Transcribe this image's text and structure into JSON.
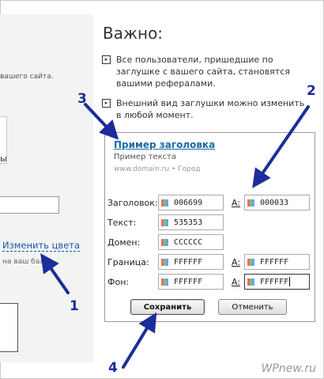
{
  "left": {
    "text1": "вашего сайта.",
    "symbol": "ы",
    "change_colors_link": "Изменить цвета",
    "text2": "на ваш бал..."
  },
  "right": {
    "title": "Важно:",
    "bullets": [
      "Все пользователи, пришедшие по заглушке с вашего сайта, становятся вашими рефералами.",
      "Внешний вид заглушки можно изменить в любой момент."
    ]
  },
  "preview": {
    "heading": "Пример заголовка",
    "text": "Пример текста",
    "url": "www.domain.ru • Город"
  },
  "form": {
    "title_label": "Заголовок:",
    "title_value": "006699",
    "title_hover_label": "A:",
    "title_hover_value": "000033",
    "text_label": "Текст:",
    "text_value": "535353",
    "domain_label": "Домен:",
    "domain_value": "CCCCCC",
    "border_label": "Граница:",
    "border_value": "FFFFFF",
    "border_hover_label": "A:",
    "border_hover_value": "FFFFFF",
    "bg_label": "Фон:",
    "bg_value": "FFFFFF",
    "bg_hover_label": "A:",
    "bg_hover_value": "FFFFFF",
    "save_label": "Сохранить",
    "cancel_label": "Отменить"
  },
  "annotations": {
    "n1": "1",
    "n2": "2",
    "n3": "3",
    "n4": "4",
    "color": "#1c2d9a"
  },
  "watermark": "WPnew.ru"
}
